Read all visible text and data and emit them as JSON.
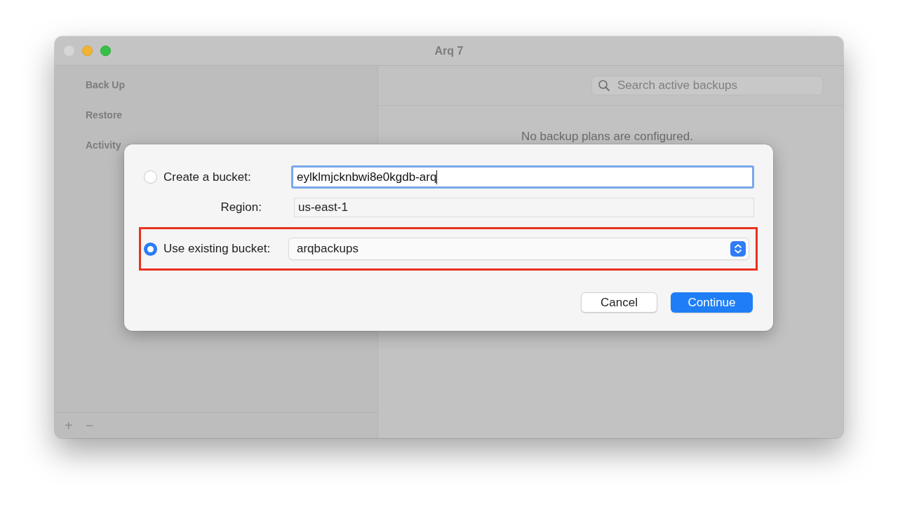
{
  "window": {
    "title": "Arq 7"
  },
  "sidebar": {
    "items": [
      {
        "label": "Back Up"
      },
      {
        "label": "Restore"
      },
      {
        "label": "Activity"
      }
    ],
    "footer_buttons": [
      "+",
      "−"
    ]
  },
  "search": {
    "placeholder": "Search active backups"
  },
  "empty_message": "No backup plans are configured.",
  "sheet": {
    "create_bucket": {
      "label": "Create a bucket:",
      "selected": false,
      "value": "eylklmjcknbwi8e0kgdb-arq",
      "focused": true
    },
    "region": {
      "label": "Region:",
      "value": "us-east-1"
    },
    "existing_bucket": {
      "label": "Use existing bucket:",
      "selected": true,
      "value": "arqbackups",
      "highlighted": true
    },
    "buttons": [
      {
        "label": "Cancel",
        "kind": "secondary"
      },
      {
        "label": "Continue",
        "kind": "primary"
      }
    ]
  }
}
